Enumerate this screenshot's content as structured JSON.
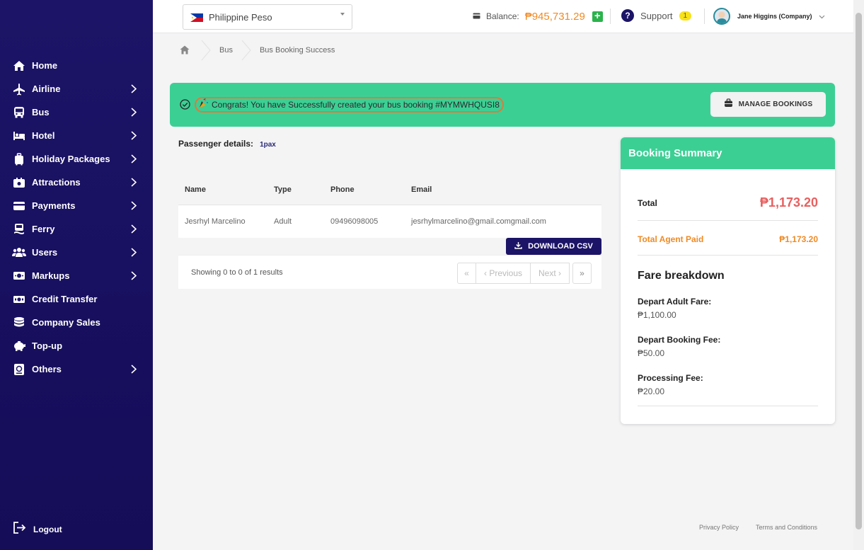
{
  "sidebar": {
    "items": [
      {
        "label": "Home",
        "icon": "home-icon",
        "chevron": false
      },
      {
        "label": "Airline",
        "icon": "airplane-icon",
        "chevron": true
      },
      {
        "label": "Bus",
        "icon": "bus-icon",
        "chevron": true
      },
      {
        "label": "Hotel",
        "icon": "bed-icon",
        "chevron": true
      },
      {
        "label": "Holiday Packages",
        "icon": "luggage-icon",
        "chevron": true
      },
      {
        "label": "Attractions",
        "icon": "ticket-icon",
        "chevron": true
      },
      {
        "label": "Payments",
        "icon": "credit-card-icon",
        "chevron": true
      },
      {
        "label": "Ferry",
        "icon": "ferry-icon",
        "chevron": true
      },
      {
        "label": "Users",
        "icon": "users-icon",
        "chevron": true
      },
      {
        "label": "Markups",
        "icon": "money-icon",
        "chevron": true
      },
      {
        "label": "Credit Transfer",
        "icon": "transfer-icon",
        "chevron": false
      },
      {
        "label": "Company Sales",
        "icon": "coins-icon",
        "chevron": false
      },
      {
        "label": "Top-up",
        "icon": "piggy-bank-icon",
        "chevron": false
      },
      {
        "label": "Others",
        "icon": "passport-icon",
        "chevron": true
      }
    ],
    "logout_label": "Logout"
  },
  "header": {
    "currency": "Philippine Peso",
    "balance_label": "Balance:",
    "balance_value": "₱945,731.29",
    "support_label": "Support",
    "support_count": "1",
    "user_name": "Jane Higgins (Company)"
  },
  "breadcrumb": {
    "items": [
      "Bus",
      "Bus Booking Success"
    ]
  },
  "banner": {
    "message": "Congrats! You have Successfully created your bus booking #MYMWHQUSI8",
    "manage_label": "MANAGE BOOKINGS"
  },
  "passengers": {
    "title": "Passenger details:",
    "count": "1pax",
    "columns": [
      "Name",
      "Type",
      "Phone",
      "Email"
    ],
    "rows": [
      {
        "name": "Jesrhyl Marcelino",
        "type": "Adult",
        "phone": "09496098005",
        "email": "jesrhylmarcelino@gmail.comgmail.com"
      }
    ],
    "download_label": "DOWNLOAD CSV",
    "results_info": "Showing 0 to 0 of 1 results",
    "pager": {
      "first": "«",
      "prev": "‹ Previous",
      "next": "Next ›",
      "last": "»"
    }
  },
  "summary": {
    "title": "Booking Summary",
    "total_label": "Total",
    "total_value": "₱1,173.20",
    "paid_label": "Total Agent Paid",
    "paid_value": "₱1,173.20",
    "fare_title": "Fare breakdown",
    "fees": [
      {
        "label": "Depart Adult Fare:",
        "value": "₱1,100.00"
      },
      {
        "label": "Depart Booking Fee:",
        "value": "₱50.00"
      },
      {
        "label": "Processing Fee:",
        "value": "₱20.00"
      }
    ]
  },
  "footer": {
    "privacy": "Privacy Policy",
    "terms": "Terms and Conditions"
  },
  "colors": {
    "sidebar": "#1c1466",
    "success": "#3ccf94",
    "accent_orange": "#f08a24",
    "total_red": "#e85f5f"
  }
}
